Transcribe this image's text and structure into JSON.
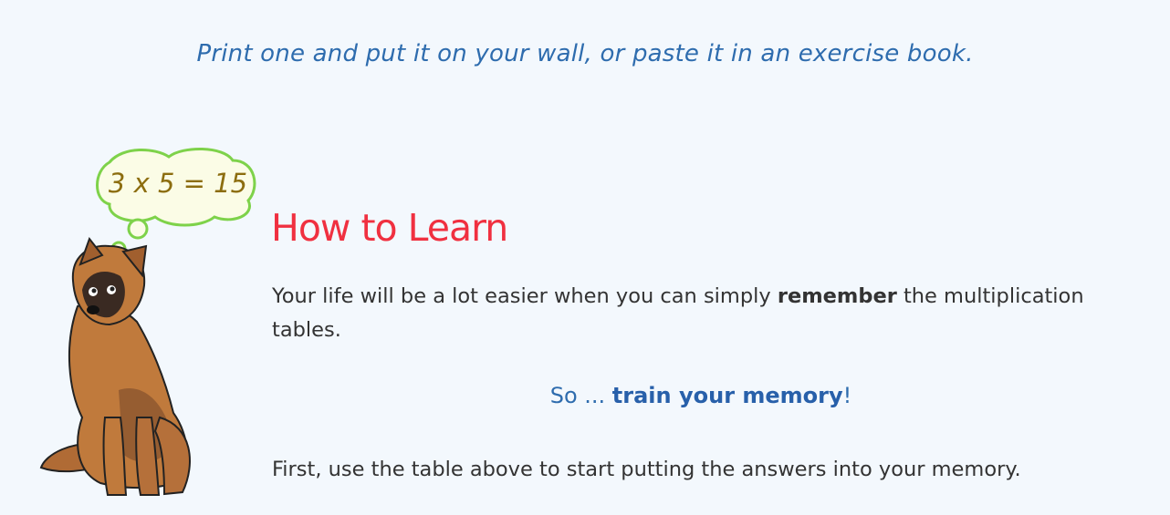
{
  "intro_text": "Print one and put it on your wall, or paste it in an exercise book.",
  "bubble": {
    "text": "3 x 5 = 15"
  },
  "section": {
    "heading": "How to Learn",
    "para1": {
      "before": "Your life will be a lot easier when you can simply ",
      "bold": "remember",
      "after": " the multiplication tables."
    },
    "callout": {
      "prefix": "So ... ",
      "bold": "train your memory",
      "suffix": "!"
    },
    "para3": "First, use the table above to start putting the answers into your memory."
  },
  "colors": {
    "background": "#f3f8fd",
    "intro": "#2e6cae",
    "heading": "#f03040",
    "body_text": "#333333",
    "callout": "#2e6cae",
    "bubble_text": "#8c6d0f",
    "bubble_outline": "#7ed24a"
  },
  "icons": {
    "illustration": "thinking-dog-icon"
  }
}
